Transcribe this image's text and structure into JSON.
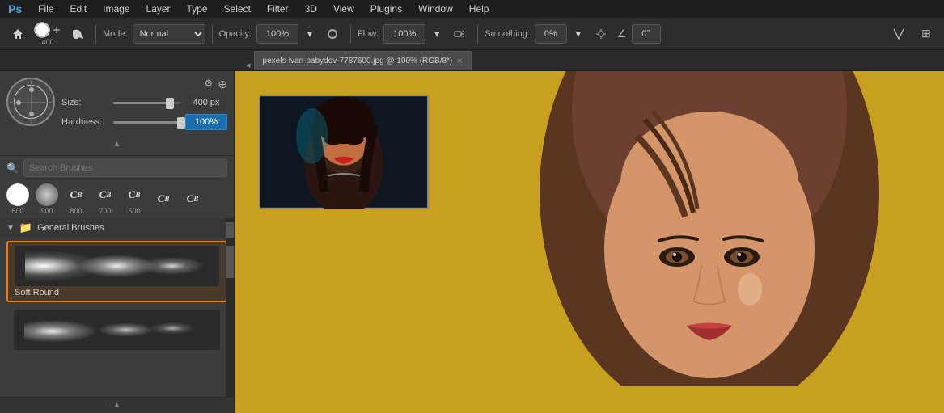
{
  "app": {
    "title": "Photoshop"
  },
  "menu": {
    "items": [
      "Ps",
      "File",
      "Edit",
      "Image",
      "Layer",
      "Type",
      "Select",
      "Filter",
      "3D",
      "View",
      "Plugins",
      "Window",
      "Help"
    ]
  },
  "toolbar": {
    "brush_size": "400",
    "brush_size_unit": "px",
    "mode_label": "Mode:",
    "mode_value": "Normal",
    "opacity_label": "Opacity:",
    "opacity_value": "100%",
    "flow_label": "Flow:",
    "flow_value": "100%",
    "smoothing_label": "Smoothing:",
    "smoothing_value": "0%",
    "angle_value": "0°"
  },
  "tab": {
    "filename": "pexels-ivan-babydov-7787600.jpg @ 100% (RGB/8*)",
    "close_symbol": "×"
  },
  "brush_panel": {
    "size_label": "Size:",
    "size_value": "400 px",
    "hardness_label": "Hardness:",
    "hardness_value": "100%",
    "search_placeholder": "Search Brushes",
    "preset_labels": [
      "600",
      "900",
      "800",
      "700",
      "500"
    ],
    "section_title": "General Brushes",
    "brushes": [
      {
        "name": "Soft Round",
        "selected": true
      },
      {
        "name": "",
        "selected": false
      }
    ]
  },
  "icons": {
    "home": "⌂",
    "brush": "✏",
    "settings": "⚙",
    "search": "🔍",
    "folder": "📁",
    "arrow_down": "▼",
    "arrow_up": "▲",
    "plus": "⊕",
    "check": "✓",
    "pen": "✒",
    "flow_icon": "≋",
    "angle_icon": "∠"
  },
  "colors": {
    "accent": "#e87d0d",
    "selected_bg": "#1a6ead",
    "toolbar_bg": "#2d2d2d",
    "panel_bg": "#3c3c3c",
    "dark_bg": "#1e1e1e"
  }
}
